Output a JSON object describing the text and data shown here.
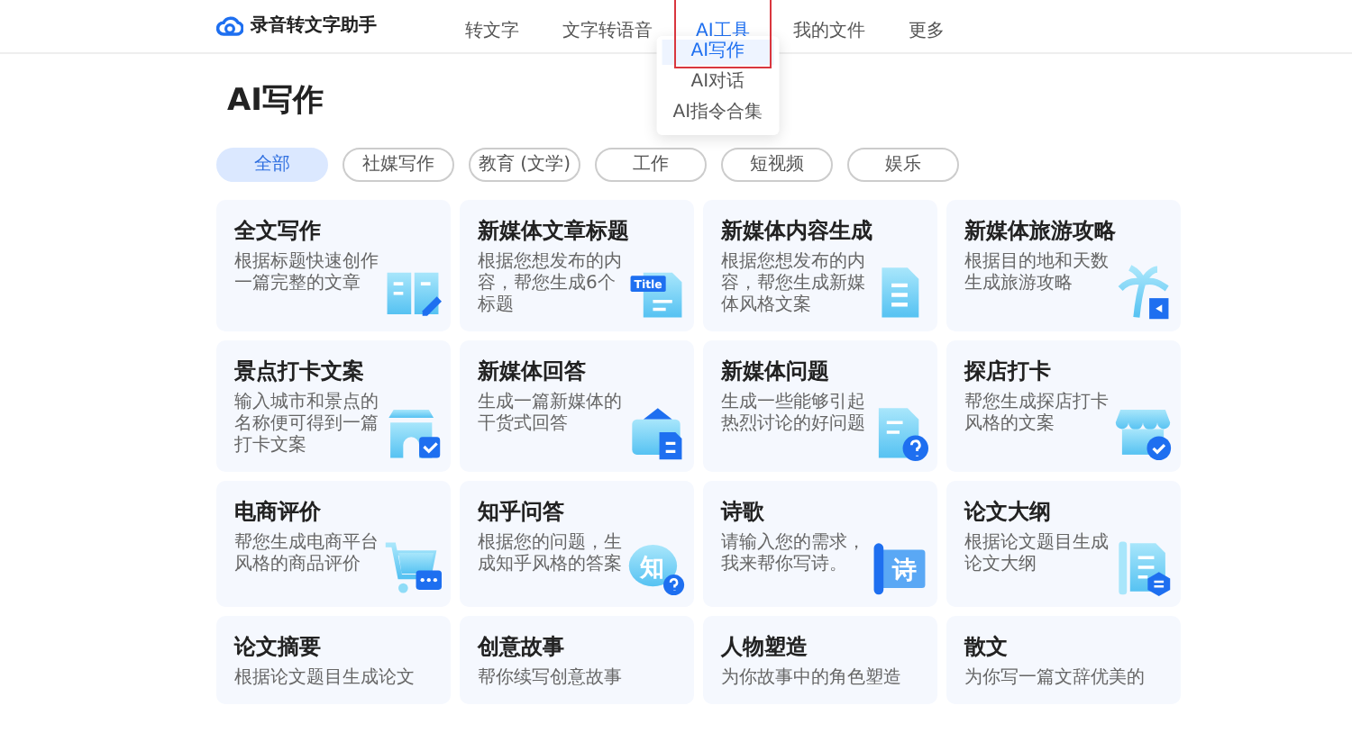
{
  "header": {
    "logo_text": "录音转文字助手",
    "nav": [
      {
        "label": "转文字",
        "selected": false
      },
      {
        "label": "文字转语音",
        "selected": false
      },
      {
        "label": "AI工具",
        "selected": true
      },
      {
        "label": "我的文件",
        "selected": false
      },
      {
        "label": "更多",
        "selected": false
      }
    ]
  },
  "dropdown": {
    "items": [
      {
        "label": "AI写作",
        "selected": true
      },
      {
        "label": "AI对话",
        "selected": false
      },
      {
        "label": "AI指令合集",
        "selected": false
      }
    ]
  },
  "page_title": "AI写作",
  "filters": [
    {
      "label": "全部",
      "selected": true
    },
    {
      "label": "社媒写作",
      "selected": false
    },
    {
      "label": "教育 (文学)",
      "selected": false
    },
    {
      "label": "工作",
      "selected": false
    },
    {
      "label": "短视频",
      "selected": false
    },
    {
      "label": "娱乐",
      "selected": false
    }
  ],
  "cards": [
    {
      "title": "全文写作",
      "description": "根据标题快速创作一篇完整的文章",
      "kind": "book"
    },
    {
      "title": "新媒体文章标题",
      "description": "根据您想发布的内容，帮您生成6个标题",
      "kind": "title",
      "icon_text": "Title"
    },
    {
      "title": "新媒体内容生成",
      "description": "根据您想发布的内容，帮您生成新媒体风格文案",
      "kind": "document"
    },
    {
      "title": "新媒体旅游攻略",
      "description": "根据目的地和天数生成旅游攻略",
      "kind": "palm"
    },
    {
      "title": "景点打卡文案",
      "description": "输入城市和景点的名称便可得到一篇打卡文案",
      "kind": "gate"
    },
    {
      "title": "新媒体回答",
      "description": "生成一篇新媒体的干货式回答",
      "kind": "box"
    },
    {
      "title": "新媒体问题",
      "description": "生成一些能够引起热烈讨论的好问题",
      "kind": "question"
    },
    {
      "title": "探店打卡",
      "description": "帮您生成探店打卡风格的文案",
      "kind": "shop"
    },
    {
      "title": "电商评价",
      "description": "帮您生成电商平台风格的商品评价",
      "kind": "cart"
    },
    {
      "title": "知乎问答",
      "description": "根据您的问题，生成知乎风格的答案",
      "kind": "bubble",
      "icon_text": "知"
    },
    {
      "title": "诗歌",
      "description": "请输入您的需求，我来帮你写诗。",
      "kind": "scroll",
      "icon_text": "诗"
    },
    {
      "title": "论文大纲",
      "description": "根据论文题目生成论文大纲",
      "kind": "outline"
    },
    {
      "title": "论文摘要",
      "description": "根据论文题目生成论文",
      "kind": "plain"
    },
    {
      "title": "创意故事",
      "description": "帮你续写创意故事",
      "kind": "plain"
    },
    {
      "title": "人物塑造",
      "description": "为你故事中的角色塑造",
      "kind": "plain"
    },
    {
      "title": "散文",
      "description": "为你写一篇文辞优美的",
      "kind": "plain"
    }
  ]
}
